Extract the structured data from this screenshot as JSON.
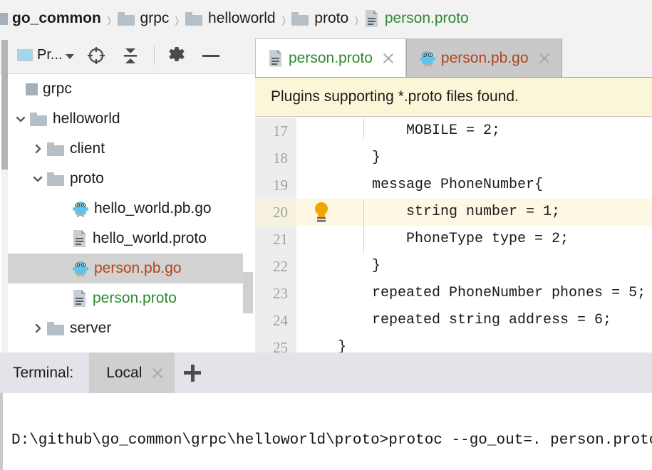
{
  "breadcrumb": {
    "separator": "›",
    "items": [
      {
        "label": "go_common",
        "icon": "module-icon",
        "type": "module",
        "bold": true
      },
      {
        "label": "grpc",
        "icon": "folder-icon",
        "type": "folder"
      },
      {
        "label": "helloworld",
        "icon": "folder-icon",
        "type": "folder"
      },
      {
        "label": "proto",
        "icon": "folder-icon",
        "type": "folder"
      },
      {
        "label": "person.proto",
        "icon": "proto-file-icon",
        "type": "proto",
        "color": "#2e8b2e"
      }
    ]
  },
  "sidebar": {
    "toolbar": {
      "project_label": "Pr...",
      "buttons": [
        {
          "name": "locate-in-tree-icon",
          "tooltip": "Select Opened File"
        },
        {
          "name": "collapse-all-icon",
          "tooltip": "Collapse All"
        },
        {
          "name": "gear-icon",
          "tooltip": "Settings"
        },
        {
          "name": "hide-icon",
          "tooltip": "Hide"
        }
      ]
    },
    "tree": [
      {
        "label": "grpc",
        "icon": "module-icon",
        "indent": 0,
        "arrow": "none",
        "selected": false
      },
      {
        "label": "helloworld",
        "icon": "folder-icon",
        "indent": 1,
        "arrow": "expanded",
        "selected": false
      },
      {
        "label": "client",
        "icon": "folder-icon",
        "indent": 2,
        "arrow": "collapsed",
        "selected": false
      },
      {
        "label": "proto",
        "icon": "folder-icon",
        "indent": 2,
        "arrow": "expanded",
        "selected": false
      },
      {
        "label": "hello_world.pb.go",
        "icon": "go-file-icon",
        "indent": 3,
        "arrow": "none",
        "selected": false,
        "color": "#1c1c1c"
      },
      {
        "label": "hello_world.proto",
        "icon": "proto-file-icon",
        "indent": 3,
        "arrow": "none",
        "selected": false,
        "color": "#1c1c1c"
      },
      {
        "label": "person.pb.go",
        "icon": "go-file-icon",
        "indent": 3,
        "arrow": "none",
        "selected": true,
        "color": "#b0451b"
      },
      {
        "label": "person.proto",
        "icon": "proto-file-icon",
        "indent": 3,
        "arrow": "none",
        "selected": false,
        "color": "#2e8b2e"
      },
      {
        "label": "server",
        "icon": "folder-icon",
        "indent": 2,
        "arrow": "collapsed",
        "selected": false
      }
    ]
  },
  "editor": {
    "tabs": [
      {
        "label": "person.proto",
        "icon": "proto-file-icon",
        "active": true,
        "color": "#2e8b2e",
        "closable": true
      },
      {
        "label": "person.pb.go",
        "icon": "go-file-icon",
        "active": false,
        "color": "#b0451b",
        "closable": true
      }
    ],
    "notification": {
      "text": "Plugins supporting *.proto files found.",
      "background": "#fcf6d8"
    },
    "gutter_icon": {
      "name": "intention-bulb-icon",
      "line": 20,
      "color": "#f0a500"
    },
    "highlighted_line": 20,
    "lines": [
      {
        "num": "17",
        "text": "        MOBILE = 2;"
      },
      {
        "num": "18",
        "text": "    }"
      },
      {
        "num": "19",
        "text": "    message PhoneNumber{"
      },
      {
        "num": "20",
        "text": "        string number = 1;"
      },
      {
        "num": "21",
        "text": "        PhoneType type = 2;"
      },
      {
        "num": "22",
        "text": "    }"
      },
      {
        "num": "23",
        "text": "    repeated PhoneNumber phones = 5;"
      },
      {
        "num": "24",
        "text": "    repeated string address = 6;"
      },
      {
        "num": "25",
        "text": "}"
      }
    ]
  },
  "terminal": {
    "title": "Terminal:",
    "tabs": [
      {
        "label": "Local",
        "active": true,
        "closable": true
      }
    ],
    "add_button": "+",
    "output": "D:\\github\\go_common\\grpc\\helloworld\\proto>protoc --go_out=. person.proto"
  },
  "colors": {
    "green_file": "#2e8b2e",
    "orange_file": "#b0451b",
    "notification_bg": "#fcf6d8",
    "selection_bg": "#d2d2d2",
    "highlight_line_bg": "#fdf7e3",
    "bulb": "#f0a500",
    "toolbar_bg": "#f2f2f2"
  }
}
